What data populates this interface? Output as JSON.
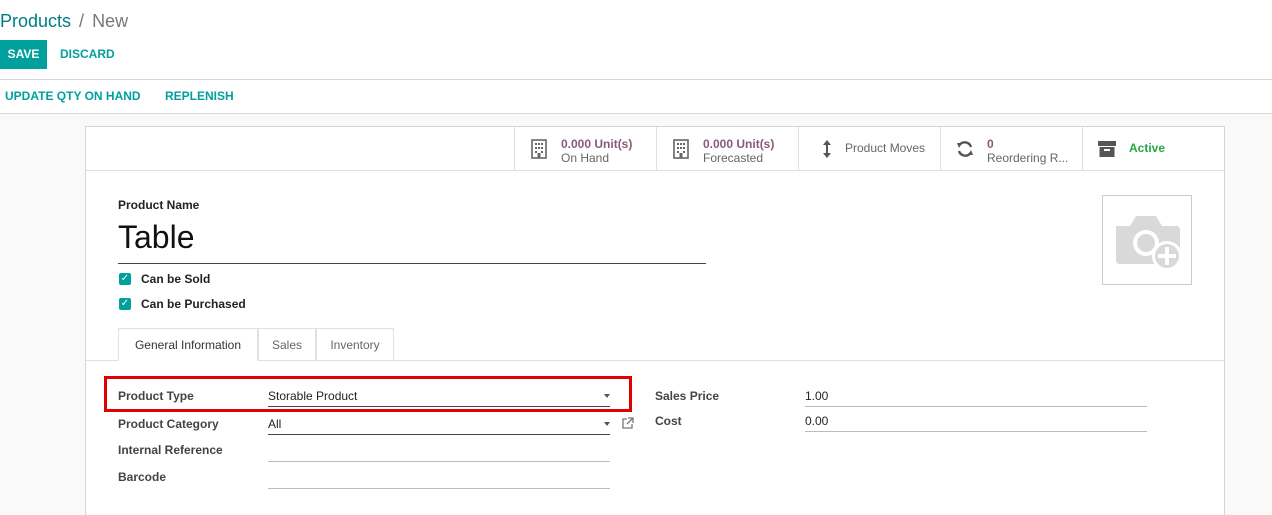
{
  "breadcrumb": {
    "parent": "Products",
    "separator": "/",
    "current": "New"
  },
  "actions": {
    "save_label": "SAVE",
    "discard_label": "DISCARD"
  },
  "statusbar": {
    "update_qty_label": "UPDATE QTY ON HAND",
    "replenish_label": "REPLENISH"
  },
  "smart_buttons": {
    "on_hand": {
      "value": "0.000 Unit(s)",
      "label": "On Hand",
      "icon": "building-icon"
    },
    "forecasted": {
      "value": "0.000 Unit(s)",
      "label": "Forecasted",
      "icon": "building-icon"
    },
    "product_moves": {
      "label": "Product Moves",
      "icon": "vertical-arrows-icon"
    },
    "reordering": {
      "value": "0",
      "label": "Reordering R...",
      "icon": "refresh-icon"
    },
    "active": {
      "label": "Active",
      "icon": "archive-icon"
    }
  },
  "product": {
    "name_label": "Product Name",
    "name": "Table",
    "can_be_sold": {
      "label": "Can be Sold",
      "checked": true
    },
    "can_be_purchased": {
      "label": "Can be Purchased",
      "checked": true
    }
  },
  "tabs": [
    {
      "label": "General Information",
      "active": true
    },
    {
      "label": "Sales",
      "active": false
    },
    {
      "label": "Inventory",
      "active": false
    }
  ],
  "general_info": {
    "product_type": {
      "label": "Product Type",
      "value": "Storable Product"
    },
    "product_category": {
      "label": "Product Category",
      "value": "All"
    },
    "internal_reference": {
      "label": "Internal Reference",
      "value": ""
    },
    "barcode": {
      "label": "Barcode",
      "value": ""
    },
    "sales_price": {
      "label": "Sales Price",
      "value": "1.00"
    },
    "cost": {
      "label": "Cost",
      "value": "0.00"
    }
  },
  "colors": {
    "primary": "#00a09d",
    "breadcrumb_link": "#017e84",
    "smart_value": "#875a7b",
    "active": "#28a745",
    "highlight": "#e00000"
  }
}
